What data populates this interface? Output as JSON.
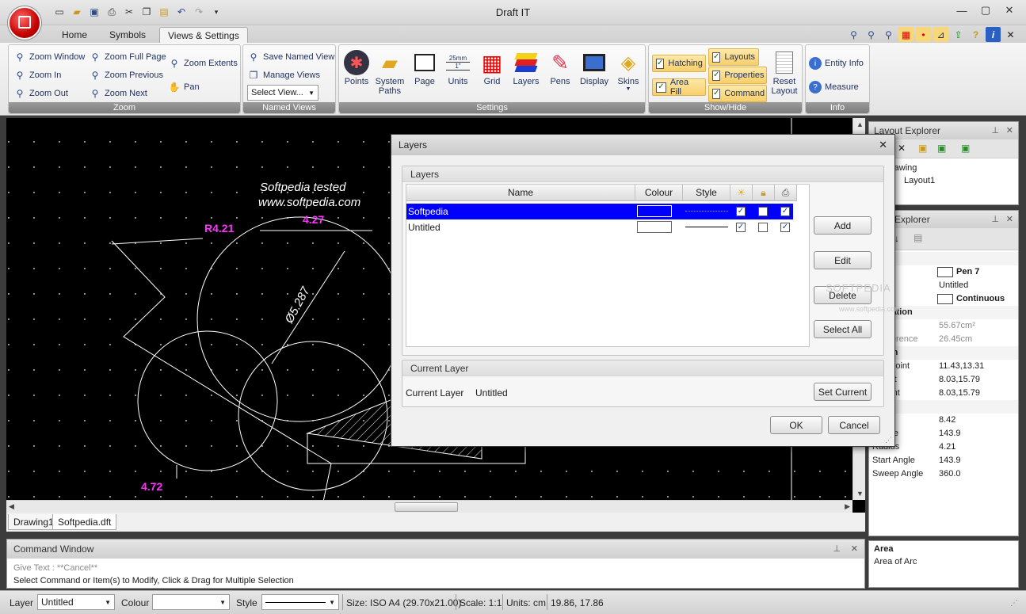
{
  "app": {
    "title": "Draft IT",
    "window_controls": {
      "minimize": "—",
      "maximize": "▢",
      "close": "✕"
    }
  },
  "ribbon": {
    "tabs": [
      {
        "label": "Home"
      },
      {
        "label": "Symbols"
      },
      {
        "label": "Views & Settings"
      }
    ],
    "active_tab": "Views & Settings",
    "zoom_group": {
      "title": "Zoom",
      "buttons": [
        "Zoom Window",
        "Zoom In",
        "Zoom Out",
        "Zoom Full Page",
        "Zoom Previous",
        "Zoom Next",
        "Zoom Extents",
        "Pan"
      ]
    },
    "named_views_group": {
      "title": "Named Views",
      "save_label": "Save Named View",
      "manage_label": "Manage Views",
      "select_value": "Select View..."
    },
    "settings_group": {
      "title": "Settings",
      "buttons": [
        "Points",
        "System",
        "Page",
        "Units",
        "Grid",
        "Layers",
        "Pens",
        "Display",
        "Skins"
      ],
      "system_line2": "Paths",
      "units_top": "25mm",
      "units_mid": "1\""
    },
    "showhide_group": {
      "title": "Show/Hide",
      "hatching": "Hatching",
      "area_fill": "Area Fill",
      "layouts": "Layouts",
      "properties": "Properties",
      "command": "Command",
      "reset_layout_1": "Reset",
      "reset_layout_2": "Layout"
    },
    "info_group": {
      "title": "Info",
      "entity_info": "Entity Info",
      "measure": "Measure"
    }
  },
  "canvas": {
    "watermark_1": "Softpedia  tested",
    "watermark_2": "www.softpedia.com",
    "dims": [
      "R4.21",
      "4.27",
      "Ø5.287",
      "4.72"
    ]
  },
  "doc_tabs": [
    "Drawing1",
    "Softpedia.dft"
  ],
  "command_window": {
    "title": "Command Window",
    "line1": "Give Text :  **Cancel**",
    "line2": "Select Command or Item(s) to Modify, Click & Drag for Multiple Selection"
  },
  "status": {
    "layer_label": "Layer",
    "layer_value": "Untitled",
    "colour_label": "Colour",
    "style_label": "Style",
    "size": "Size: ISO A4 (29.70x21.00)",
    "scale": "Scale: 1:1",
    "units": "Units: cm",
    "coords": "19.86, 17.86"
  },
  "layout_explorer": {
    "title": "Layout Explorer",
    "item_drawing": "rawing",
    "item_layout": "Layout1"
  },
  "properties_explorer": {
    "title": "rties Explorer",
    "rows": [
      {
        "k": "neral",
        "v": "",
        "type": "cat"
      },
      {
        "k": "our",
        "v": "Pen 7",
        "type": "swatch"
      },
      {
        "k": "er",
        "v": "Untitled",
        "type": "row"
      },
      {
        "k": "estyle",
        "v": "Continuous",
        "type": "swatch"
      },
      {
        "k": "formation",
        "v": "",
        "type": "cat"
      },
      {
        "k": "ea",
        "v": "55.67cm²",
        "type": "dim"
      },
      {
        "k": "cumference",
        "v": "26.45cm",
        "type": "dim"
      },
      {
        "k": "cation",
        "v": "",
        "type": "cat"
      },
      {
        "k": "ntre Point",
        "v": "11.43,13.31",
        "type": "row"
      },
      {
        "k": "l Point",
        "v": "8.03,15.79",
        "type": "row"
      },
      {
        "k": "rt Point",
        "v": "8.03,15.79",
        "type": "row"
      },
      {
        "k": "es",
        "v": "",
        "type": "cat"
      },
      {
        "k": "meter",
        "v": "8.42",
        "type": "row"
      },
      {
        "k": "l Angle",
        "v": "143.9",
        "type": "row"
      },
      {
        "k": "Radius",
        "v": "4.21",
        "type": "row"
      },
      {
        "k": "Start Angle",
        "v": "143.9",
        "type": "row"
      },
      {
        "k": "Sweep Angle",
        "v": "360.0",
        "type": "row"
      }
    ]
  },
  "help_panel": {
    "title": "Area",
    "text": "Area of Arc"
  },
  "layers_dialog": {
    "title": "Layers",
    "group_title": "Layers",
    "columns": [
      "Name",
      "Colour",
      "Style"
    ],
    "rows": [
      {
        "name": "Softpedia",
        "colour": "#0000ff",
        "visible": true,
        "locked": false,
        "print": true,
        "selected": true
      },
      {
        "name": "Untitled",
        "colour": "#ffffff",
        "visible": true,
        "locked": false,
        "print": true,
        "selected": false
      }
    ],
    "buttons": [
      "Add",
      "Edit",
      "Delete",
      "Select All"
    ],
    "current_group_title": "Current Layer",
    "current_label": "Current Layer",
    "current_value": "Untitled",
    "set_current": "Set Current",
    "ok": "OK",
    "cancel": "Cancel",
    "watermark": "SOFTPEDIA",
    "watermark_url": "www.softpedia.com"
  }
}
